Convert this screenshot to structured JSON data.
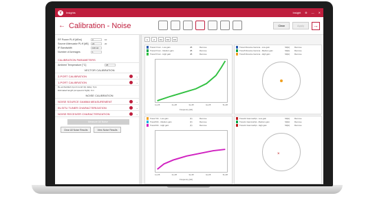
{
  "app": {
    "title": "Insights",
    "user": "Insight",
    "menu_items": [
      "aind",
      "?"
    ]
  },
  "toolbar": {
    "title": "Calibration - Noise",
    "clear_label": "Clear",
    "apply_label": "Apply"
  },
  "left": {
    "fields": [
      {
        "label": "RF Power PL:ff [dBm]",
        "value": "0",
        "value2": "10"
      },
      {
        "label": "Source Attenuator PL:ff [dB]",
        "value": "20",
        "value2": "20"
      },
      {
        "label": "IF Bandwidth",
        "value": "100 Hz",
        "value2": ""
      },
      {
        "label": "Number of Averages",
        "value": "1",
        "value2": ""
      }
    ],
    "cal_params_title": "CALIBRATION PARAMETERS",
    "ambient_label": "Ambient Temperature [°C]",
    "ambient_value": "25",
    "vector_title": "VECTOR CALIBRATION",
    "two_port": "2-PORT CALIBRATION",
    "one_port": "1-PORT CALIBRATION",
    "note1": "De-embedded 2-port round trip delay: 0 ps",
    "note2": "Estimated length (at speed of light): 0 m",
    "noise_title": "NOISE CALIBRATION",
    "noise_items": [
      "NOISE SOURCE GAMMA MEASUREMENT",
      "IN-SITU TUNER CHARACTERIZATION",
      "NOISE RECEIVER CHARACTERIZATION"
    ],
    "measure_all": "Measure All Noise",
    "clear_all": "Clear All Noise Results",
    "view_results": "View Noise Results"
  },
  "tabs": [
    "1",
    "2",
    "F1",
    "F2",
    "F3"
  ],
  "panels": {
    "top_left_traces": [
      {
        "name": "Trace1 From - Low gain",
        "extra": "dB",
        "action": "Remove",
        "color": "#2a5db0"
      },
      {
        "name": "Trace2 From - Medium gain",
        "extra": "dB",
        "action": "Remove",
        "color": "#12a64a"
      },
      {
        "name": "Trace3 From - High gain",
        "extra": "dB",
        "action": "Remove",
        "color": "#30c040"
      }
    ],
    "top_right_traces": [
      {
        "name": "Trace4 Receive Gamma - Low gain",
        "extra": "S4[H]",
        "action": "Remove",
        "color": "#2a5db0"
      },
      {
        "name": "Trace5 Receive Gamma - Medium gain",
        "extra": "S4[H]",
        "action": "Remove",
        "color": "#12a64a"
      },
      {
        "name": "Trace6 Receive Gamma - High gain",
        "extra": "S4[H]",
        "action": "Remove",
        "color": "#f0a020"
      }
    ],
    "bottom_left_traces": [
      {
        "name": "Trace7 Rn - Low gain",
        "extra": "(F)",
        "action": "Remove",
        "color": "#f0a020"
      },
      {
        "name": "Trace8 Rn - Medium gain",
        "extra": "(F)",
        "action": "Remove",
        "color": "#20b0e0"
      },
      {
        "name": "Trace9 Rn - High gain",
        "extra": "(F)",
        "action": "Remove",
        "color": "#d020c0"
      }
    ],
    "bottom_right_traces": [
      {
        "name": "Trace10 GammaOpt - Low gain",
        "extra": "S4[H]",
        "action": "Remove",
        "color": "#c02020"
      },
      {
        "name": "Trace11 GammaOpt - Medium gain",
        "extra": "S4[H]",
        "action": "Remove",
        "color": "#12a64a"
      },
      {
        "name": "Trace12 GammaOpt - High gain",
        "extra": "S4[H]",
        "action": "Remove",
        "color": "#c02020"
      }
    ],
    "x_label": "Frequency [Hz]",
    "x_ticks": [
      "1e+08",
      "2e+08",
      "3e+08",
      "4e+08",
      "5e+08"
    ]
  }
}
